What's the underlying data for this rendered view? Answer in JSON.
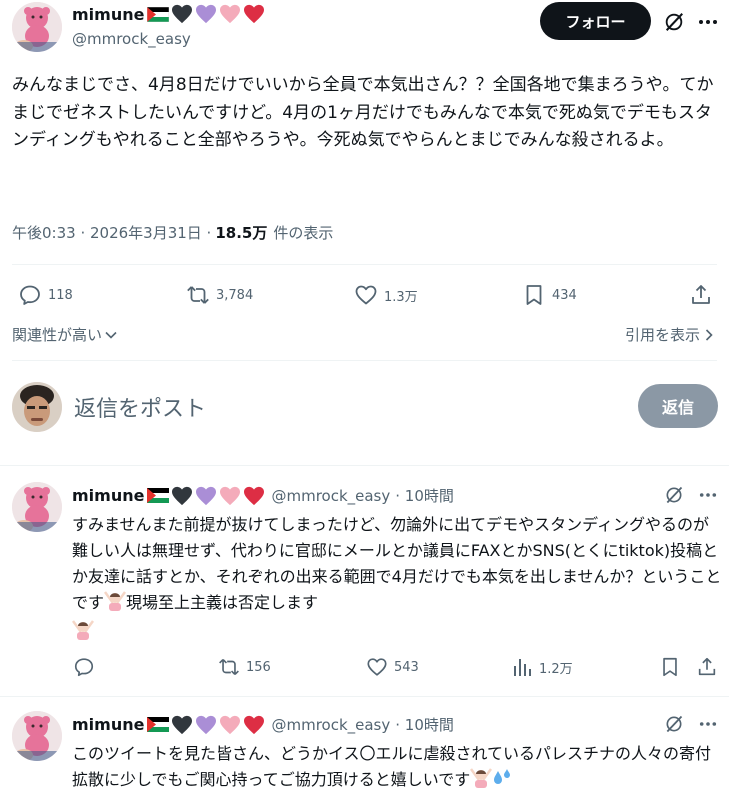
{
  "main_post": {
    "display_name": "mimune",
    "handle": "@mmrock_easy",
    "follow_label": "フォロー",
    "text": "みんなまじでさ、4月8日だけでいいから全員で本気出さん？？全国各地で集まろうや。てかまじでゼネストしたいんですけど。4月の1ヶ月だけでもみんなで本気で死ぬ気でデモもスタンディングもやれること全部やろうや。今死ぬ気でやらんとまじでみんな殺されるよ。",
    "timestamp": "午後0:33 · 2026年3月31日 ·",
    "views_count": "18.5万",
    "views_label": "件の表示",
    "stats": {
      "replies": "118",
      "reposts": "3,784",
      "likes": "1.3万",
      "bookmarks": "434"
    }
  },
  "sort": {
    "label": "関連性が高い",
    "quotes_label": "引用を表示"
  },
  "composer": {
    "placeholder": "返信をポスト",
    "button_label": "返信"
  },
  "replies": [
    {
      "display_name": "mimune",
      "handle": "@mmrock_easy",
      "time": "· 10時間",
      "text": "すみませんまた前提が抜けてしまったけど、勿論外に出てデモやスタンディングやるのが難しい人は無理せず、代わりに官邸にメールとか議員にFAXとかSNS(とくにtiktok)投稿とか友達に話すとか、それぞれの出来る範囲で4月だけでも本気を出しませんか？ということです",
      "text_tail": "現場至上主義は否定します",
      "stats": {
        "replies": "",
        "reposts": "156",
        "likes": "543",
        "views": "1.2万"
      }
    },
    {
      "display_name": "mimune",
      "handle": "@mmrock_easy",
      "time": "· 10時間",
      "text": "このツイートを見た皆さん、どうかイス〇エルに虐殺されているパレスチナの人々の寄付拡散に少しでもご関心持ってご協力頂けると嬉しいです"
    }
  ],
  "colors": {
    "text": "#0f1419",
    "secondary": "#536471",
    "divider": "#eff3f4",
    "follow_bg": "#0f1419",
    "reply_btn_bg": "#8b98a5"
  },
  "icons": [
    "palestine-flag-icon",
    "black-heart-icon",
    "purple-heart-icon",
    "pink-heart-icon",
    "red-heart-icon",
    "grok-icon",
    "more-icon",
    "reply-icon",
    "repost-icon",
    "like-icon",
    "bookmark-icon",
    "share-icon",
    "views-icon",
    "chevron-down-icon",
    "chevron-right-icon",
    "person-gesturing-no-icon",
    "sweat-droplets-icon"
  ]
}
